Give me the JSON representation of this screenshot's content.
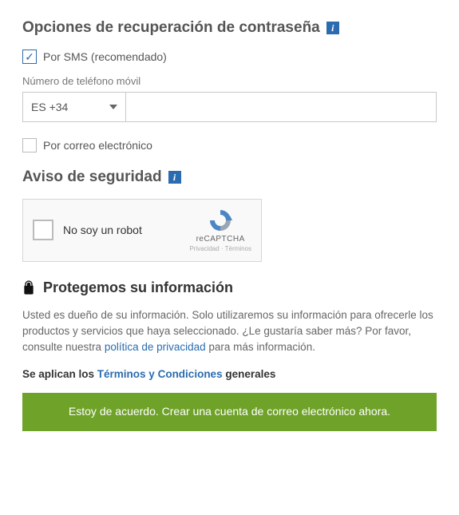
{
  "recovery": {
    "title": "Opciones de recuperación de contraseña",
    "sms_label": "Por SMS (recomendado)",
    "sms_checked": true,
    "phone_label": "Número de teléfono móvil",
    "country_code_selected": "ES +34",
    "phone_value": "",
    "email_label": "Por correo electrónico",
    "email_checked": false
  },
  "security": {
    "title": "Aviso de seguridad",
    "recaptcha_label": "No soy un robot",
    "recaptcha_brand": "reCAPTCHA",
    "recaptcha_legal": "Privacidad · Términos"
  },
  "protect": {
    "heading": "Protegemos su información",
    "paragraph_pre": "Usted es dueño de su información. Solo utilizaremos su información para ofrecerle los productos y servicios que haya seleccionado. ¿Le gustaría saber más? Por favor, consulte nuestra ",
    "privacy_link": "política de privacidad",
    "paragraph_post": " para más información."
  },
  "terms": {
    "prefix": "Se aplican los ",
    "link": "Términos y Condiciones",
    "suffix": " generales"
  },
  "submit": {
    "label": "Estoy de acuerdo. Crear una cuenta de correo electrónico ahora."
  },
  "colors": {
    "accent_blue": "#2b6cb0",
    "button_green": "#6fa229"
  }
}
